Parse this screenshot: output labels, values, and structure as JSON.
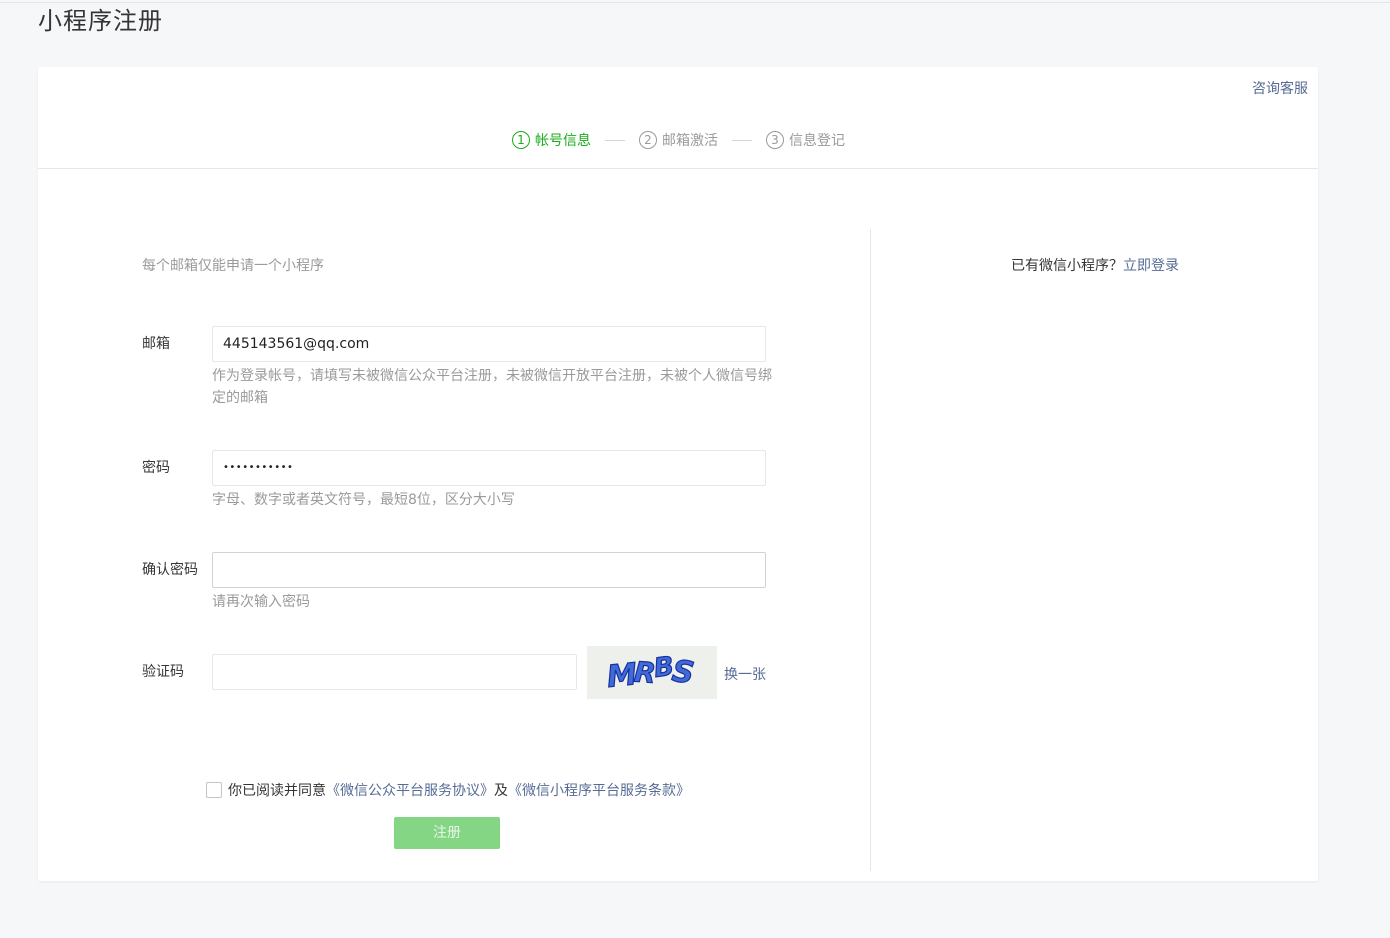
{
  "page": {
    "title": "小程序注册"
  },
  "header": {
    "consult_link": "咨询客服"
  },
  "steps": [
    {
      "number": "1",
      "label": "帐号信息",
      "active": true
    },
    {
      "number": "2",
      "label": "邮箱激活",
      "active": false
    },
    {
      "number": "3",
      "label": "信息登记",
      "active": false
    }
  ],
  "form": {
    "tip": "每个邮箱仅能申请一个小程序",
    "email": {
      "label": "邮箱",
      "value": "445143561@qq.com",
      "hint": "作为登录帐号，请填写未被微信公众平台注册，未被微信开放平台注册，未被个人微信号绑定的邮箱"
    },
    "password": {
      "label": "密码",
      "value": "•••••••••••",
      "hint": "字母、数字或者英文符号，最短8位，区分大小写"
    },
    "confirm_password": {
      "label": "确认密码",
      "value": "",
      "hint": "请再次输入密码"
    },
    "captcha": {
      "label": "验证码",
      "value": "",
      "image_text": "MRBS",
      "refresh_label": "换一张"
    },
    "agreement": {
      "checked": false,
      "prefix": "你已阅读并同意",
      "link1": "《微信公众平台服务协议》",
      "middle": "及",
      "link2": "《微信小程序平台服务条款》"
    },
    "submit_label": "注册"
  },
  "side": {
    "prompt": "已有微信小程序？",
    "login_link": "立即登录"
  },
  "colors": {
    "accent_green": "#1aad19",
    "link_blue": "#576b95",
    "disabled_button": "#84d584",
    "muted_text": "#9a9a9a"
  }
}
